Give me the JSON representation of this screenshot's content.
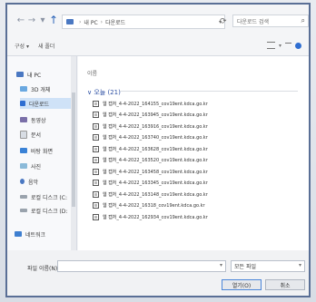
{
  "address": {
    "pc": "내 PC",
    "folder": "다운로드"
  },
  "search": {
    "placeholder": "다운로드 검색"
  },
  "toolbar": {
    "organize": "구성 ▾",
    "new_folder": "새 폴더"
  },
  "navigation": {
    "items": [
      {
        "label": "내 PC",
        "icon": "pc-icon"
      },
      {
        "label": "3D 개체",
        "icon": "3d-objects-icon"
      },
      {
        "label": "다운로드",
        "icon": "download-icon"
      },
      {
        "label": "동영상",
        "icon": "video-icon"
      },
      {
        "label": "문서",
        "icon": "document-icon"
      },
      {
        "label": "바탕 화면",
        "icon": "desktop-icon"
      },
      {
        "label": "사진",
        "icon": "picture-icon"
      },
      {
        "label": "음악",
        "icon": "music-icon"
      },
      {
        "label": "로컬 디스크 (C:",
        "icon": "disk-icon"
      },
      {
        "label": "로컬 디스크 (D:",
        "icon": "disk-icon"
      },
      {
        "label": "네트워크",
        "icon": "network-icon"
      }
    ]
  },
  "file_pane": {
    "header_name": "이름",
    "group_label": "∨ 오늘 (21)",
    "files": [
      "웹 캡처_4-4-2022_164155_cov19ent.kdca.go.kr",
      "웹 캡처_4-4-2022_163945_cov19ent.kdca.go.kr",
      "웹 캡처_4-4-2022_163916_cov19ent.kdca.go.kr",
      "웹 캡처_4-4-2022_163740_cov19ent.kdca.go.kr",
      "웹 캡처_4-4-2022_163628_cov19ent.kdca.go.kr",
      "웹 캡처_4-4-2022_163520_cov19ent.kdca.go.kr",
      "웹 캡처_4-4-2022_163458_cov19ent.kdca.go.kr",
      "웹 캡처_4-4-2022_163345_cov19ent.kdca.go.kr",
      "웹 캡처_4-4-2022_163148_cov19ent.kdca.go.kr",
      "웹 캡처_4-4-2022_16318_cov19ent.kdca.go.kr",
      "웹 캡처_4-4-2022_162934_cov19ent.kdca.go.kr"
    ]
  },
  "footer": {
    "filename_label": "파일 이름(N):",
    "filename_value": "",
    "filetype": "모든 파일",
    "open_label": "열기(O)",
    "cancel_label": "취소"
  },
  "colors": {
    "accent": "#2c4fa3",
    "frame": "#5a6f96"
  }
}
